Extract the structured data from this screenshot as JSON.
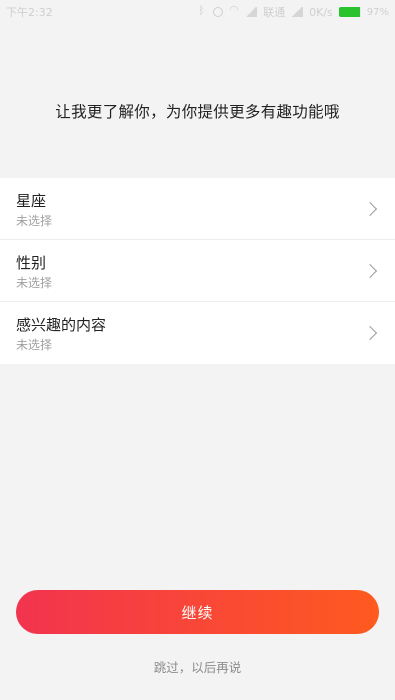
{
  "status_bar": {
    "time": "下午2:32",
    "network_label": "联通",
    "network_speed": "0K/s",
    "battery_percent": "97%",
    "battery_level": 0.97,
    "battery_color": "#29c32f"
  },
  "headline": "让我更了解你，为你提供更多有趣功能哦",
  "items": [
    {
      "title": "星座",
      "subtitle": "未选择"
    },
    {
      "title": "性别",
      "subtitle": "未选择"
    },
    {
      "title": "感兴趣的内容",
      "subtitle": "未选择"
    }
  ],
  "continue_label": "继续",
  "skip_label": "跳过，以后再说",
  "colors": {
    "button_gradient_start": "#f2334f",
    "button_gradient_end": "#ff5a1f"
  }
}
